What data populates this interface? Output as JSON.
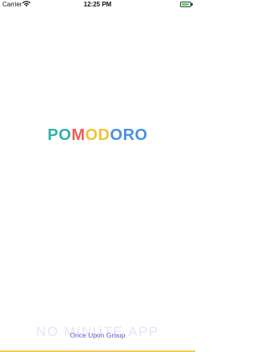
{
  "status_bar": {
    "carrier": "Carrier",
    "time": "12:25 PM",
    "battery_level_percent": 85
  },
  "logo": {
    "letters": [
      {
        "char": "P",
        "color": "#2fb3a7"
      },
      {
        "char": "O",
        "color": "#2fb3a7"
      },
      {
        "char": "M",
        "color": "#f05a5a"
      },
      {
        "char": "O",
        "color": "#f2c23d"
      },
      {
        "char": "D",
        "color": "#f2c23d"
      },
      {
        "char": "O",
        "color": "#4a90e2"
      },
      {
        "char": "R",
        "color": "#4a90e2"
      },
      {
        "char": "O",
        "color": "#4a90e2"
      }
    ]
  },
  "background_text": "NO MINUTE.APP",
  "footer": {
    "text": "Once Upon Group",
    "accent_bar_color": "#f3c95b"
  }
}
